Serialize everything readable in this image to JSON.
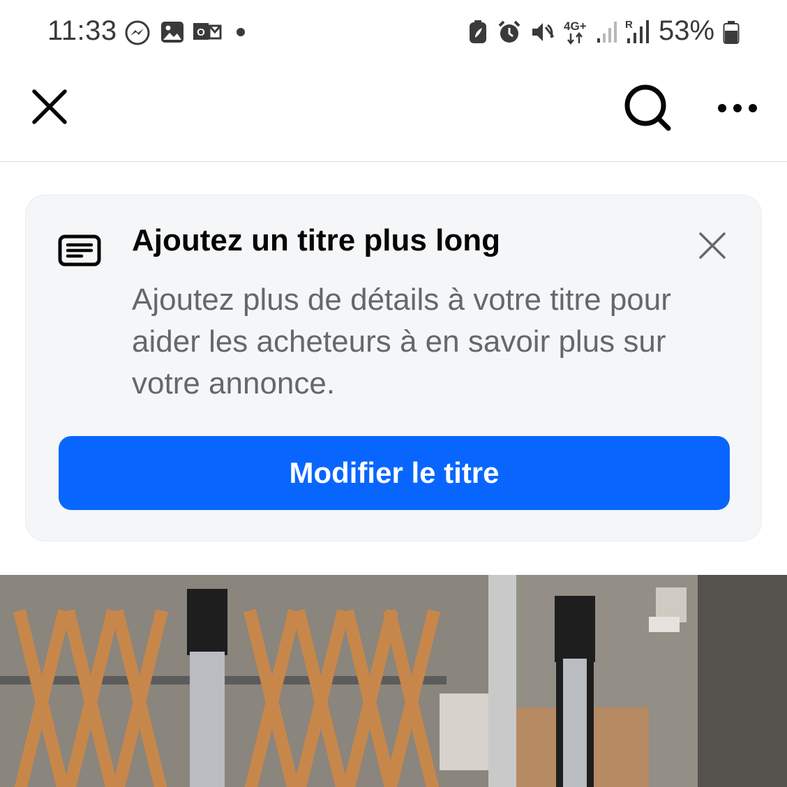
{
  "status_bar": {
    "time": "11:33",
    "battery_percent": "53%",
    "network_type": "4G+",
    "icons": [
      "messenger-icon",
      "gallery-icon",
      "outlook-icon",
      "notification-dot-icon",
      "battery-saver-icon",
      "alarm-icon",
      "mute-icon",
      "network-4g-icon",
      "signal-icon",
      "roaming-signal-icon",
      "battery-icon"
    ]
  },
  "nav": {
    "icons": [
      "close-icon",
      "search-icon",
      "more-options-icon"
    ]
  },
  "tip_card": {
    "title": "Ajoutez un titre plus long",
    "description": "Ajoutez plus de détails à votre titre pour aider les acheteurs à en savoir plus sur votre annonce.",
    "button_label": "Modifier le titre",
    "icon": "listing-text-icon"
  },
  "colors": {
    "accent": "#0866ff",
    "card_background": "#f5f6f8",
    "secondary_text": "#65676b"
  }
}
